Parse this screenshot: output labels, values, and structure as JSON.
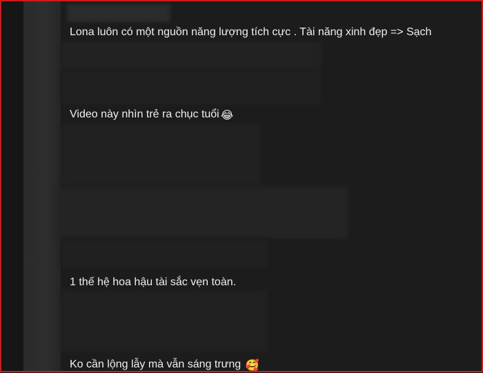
{
  "comments": [
    {
      "text": "Lona luôn có một nguồn năng lượng tích cực . Tài năng xinh đẹp => Sạch",
      "emoji": ""
    },
    {
      "text": "Video này nhìn trẻ ra chục tuổi",
      "emoji": "😂"
    },
    {
      "text": "1 thế hệ hoa hậu tài sắc vẹn toàn.",
      "emoji": ""
    },
    {
      "text": "Ko cần lộng lẫy mà vẫn sáng trưng ",
      "emoji": "🥰"
    }
  ]
}
